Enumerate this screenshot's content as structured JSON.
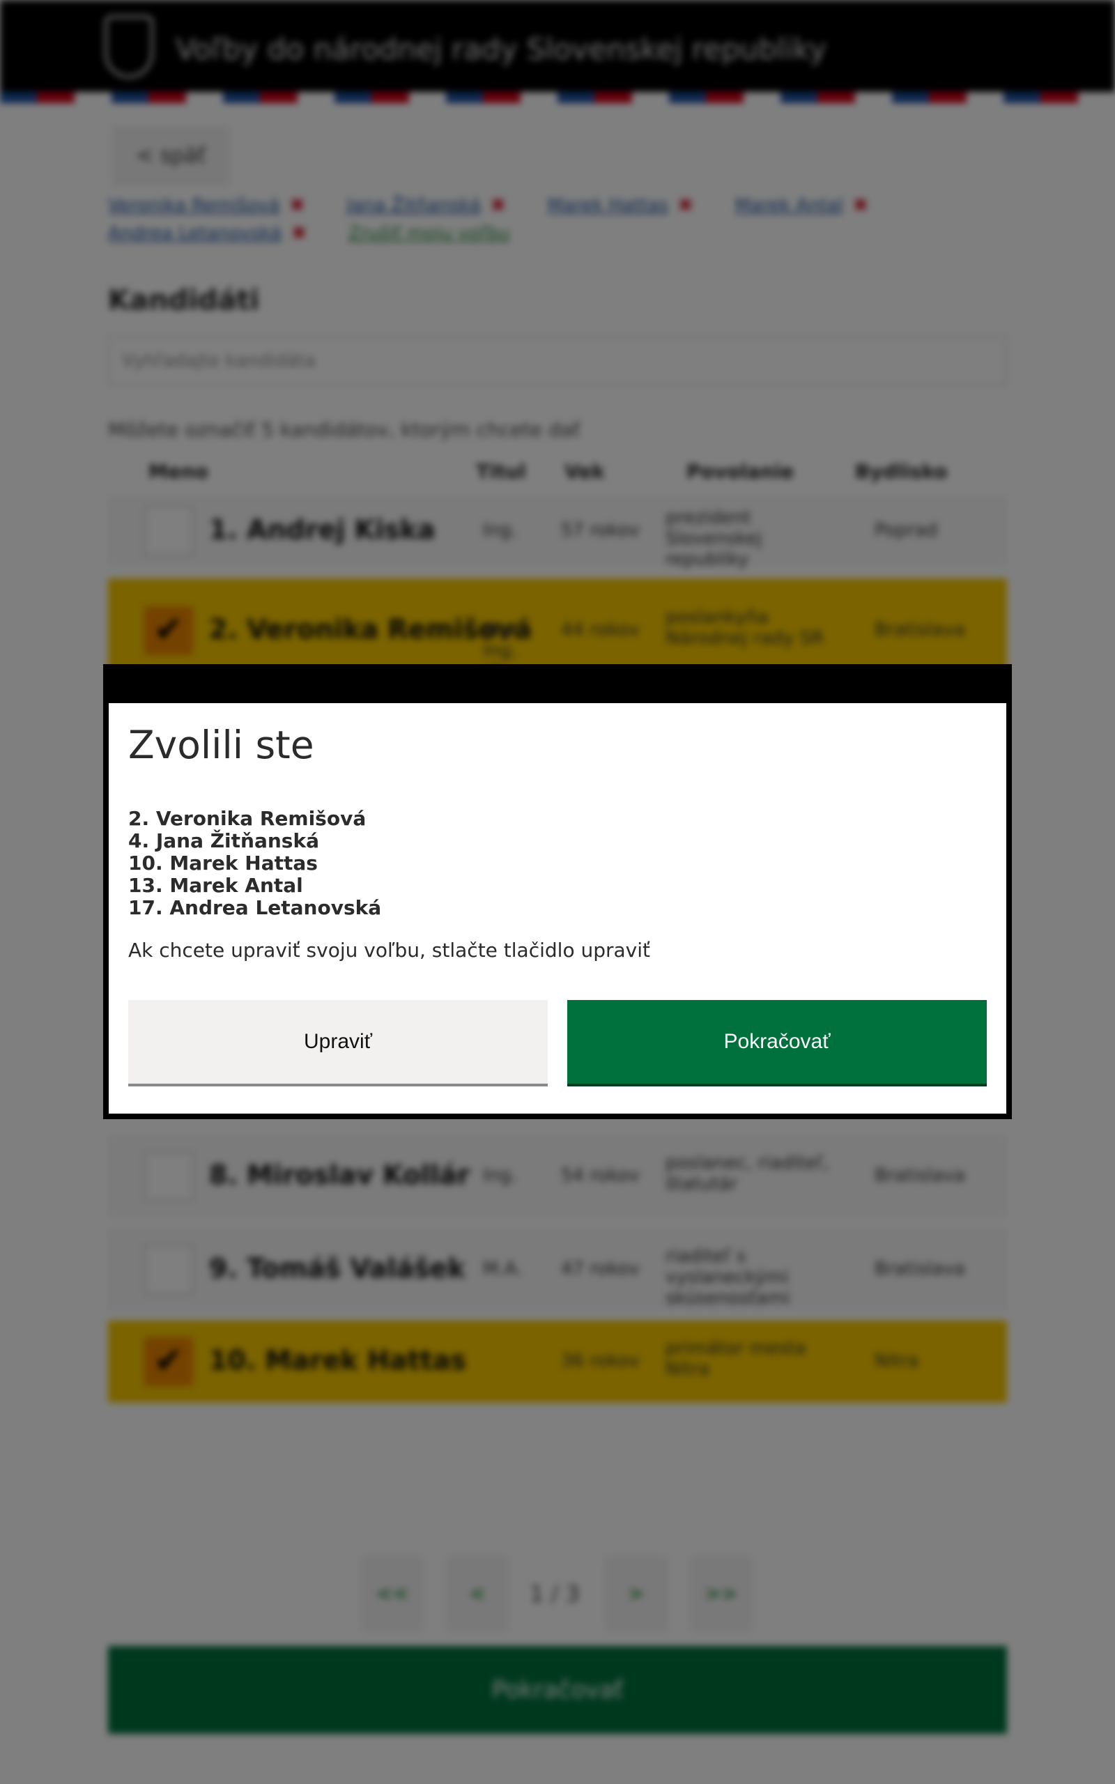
{
  "header": {
    "site_title": "Voľby do národnej rady Slovenskej republiky",
    "flag_colors": [
      "#1a4fa0",
      "#d0021b",
      "#ffffff"
    ]
  },
  "nav": {
    "back_label": "< späť"
  },
  "chosen_links": [
    {
      "label": "Veronika Remišová",
      "removable": true
    },
    {
      "label": "Jana Žitňanská",
      "removable": true
    },
    {
      "label": "Marek Hattas",
      "removable": true
    },
    {
      "label": "Marek Antal",
      "removable": true
    },
    {
      "label": "Andrea Letanovská",
      "removable": true
    },
    {
      "label": "Zrušiť moju voľbu",
      "removable": false
    }
  ],
  "candidates_section": {
    "title": "Kandidáti",
    "search_placeholder": "Vyhľadajte kandidáta",
    "hint": "Môžete označiť 5 kandidátov, ktorým chcete dať",
    "columns": [
      "Meno",
      "Titul",
      "Vek",
      "Povolanie",
      "Bydlisko"
    ]
  },
  "candidate_rows": [
    {
      "name": "1. Andrej Kiska",
      "title": "Ing.",
      "age": "57 rokov",
      "occupation": "prezident Slovenskej republiky",
      "residence": "Poprad",
      "selected": false
    },
    {
      "name": "2. Veronika Remišová",
      "title": "Mgr. Ing. et Mgr.",
      "age": "44 rokov",
      "occupation": "poslankyňa Národnej rady SR",
      "residence": "Bratislava",
      "selected": true
    },
    {
      "name": "8. Miroslav Kollár",
      "title": "Ing.",
      "age": "54 rokov",
      "occupation": "poslanec, riaditeľ, štatutár",
      "residence": "Bratislava",
      "selected": false
    },
    {
      "name": "9. Tomáš Valášek",
      "title": "M.A.",
      "age": "47 rokov",
      "occupation": "riaditeľ s vyslaneckými skúsenosťami",
      "residence": "Bratislava",
      "selected": false
    },
    {
      "name": "10. Marek Hattas",
      "title": "",
      "age": "36 rokov",
      "occupation": "primátor mesta Nitra",
      "residence": "Nitra",
      "selected": true
    }
  ],
  "pagination": {
    "first": "<<",
    "prev": "<",
    "info": "1 / 3",
    "next": ">",
    "last": ">>"
  },
  "submit_label": "Pokračovať",
  "modal": {
    "title": "Zvolili ste",
    "selected": [
      "2. Veronika Remišová",
      "4. Jana Žitňanská",
      "10. Marek Hattas",
      "13. Marek Antal",
      "17. Andrea Letanovská"
    ],
    "message": "Ak chcete upraviť svoju voľbu, stlačte tlačidlo upraviť",
    "edit_label": "Upraviť",
    "continue_label": "Pokračovať"
  },
  "colors": {
    "accent_green": "#00703c",
    "selected_row": "#f6c600",
    "link_blue": "#1a4fa0",
    "remove_red": "#d0021b"
  }
}
